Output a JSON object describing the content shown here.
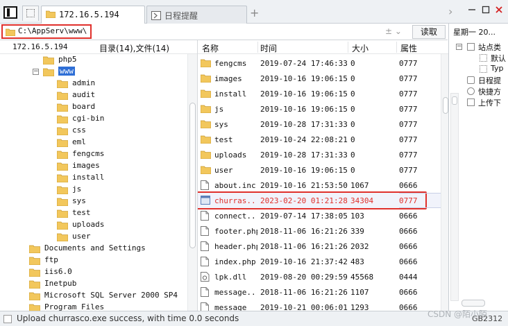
{
  "tabs": {
    "active": {
      "label": "172.16.5.194",
      "icon": "folder-icon"
    },
    "inactive": {
      "label": "日程提醒",
      "icon": "clock-icon"
    },
    "add_label": "+",
    "scroll_right": "›"
  },
  "address": {
    "path": "C:\\AppServ\\www\\",
    "extra": "±  ⌄",
    "read_button": "读取"
  },
  "tree": {
    "host": "172.16.5.194",
    "summary": "目录(14),文件(14)",
    "items": [
      {
        "label": "php5"
      },
      {
        "label": "www"
      },
      {
        "label": "admin"
      },
      {
        "label": "audit"
      },
      {
        "label": "board"
      },
      {
        "label": "cgi-bin"
      },
      {
        "label": "css"
      },
      {
        "label": "eml"
      },
      {
        "label": "fengcms"
      },
      {
        "label": "images"
      },
      {
        "label": "install"
      },
      {
        "label": "js"
      },
      {
        "label": "sys"
      },
      {
        "label": "test"
      },
      {
        "label": "uploads"
      },
      {
        "label": "user"
      },
      {
        "label": "Documents and Settings"
      },
      {
        "label": "ftp"
      },
      {
        "label": "iis6.0"
      },
      {
        "label": "Inetpub"
      },
      {
        "label": "Microsoft SQL Server 2000 SP4"
      },
      {
        "label": "Program Files"
      }
    ]
  },
  "files": {
    "headers": {
      "name": "名称",
      "time": "时间",
      "size": "大小",
      "attr": "属性"
    },
    "rows": [
      {
        "name": "fengcms",
        "time": "2019-07-24 17:46:33",
        "size": "0",
        "attr": "0777",
        "icon": "folder-icon"
      },
      {
        "name": "images",
        "time": "2019-10-16 19:06:15",
        "size": "0",
        "attr": "0777",
        "icon": "folder-icon"
      },
      {
        "name": "install",
        "time": "2019-10-16 19:06:15",
        "size": "0",
        "attr": "0777",
        "icon": "folder-icon"
      },
      {
        "name": "js",
        "time": "2019-10-16 19:06:15",
        "size": "0",
        "attr": "0777",
        "icon": "folder-icon"
      },
      {
        "name": "sys",
        "time": "2019-10-28 17:31:33",
        "size": "0",
        "attr": "0777",
        "icon": "folder-icon"
      },
      {
        "name": "test",
        "time": "2019-10-24 22:08:21",
        "size": "0",
        "attr": "0777",
        "icon": "folder-icon"
      },
      {
        "name": "uploads",
        "time": "2019-10-28 17:31:33",
        "size": "0",
        "attr": "0777",
        "icon": "folder-icon"
      },
      {
        "name": "user",
        "time": "2019-10-16 19:06:15",
        "size": "0",
        "attr": "0777",
        "icon": "folder-icon"
      },
      {
        "name": "about.inc",
        "time": "2019-10-16 21:53:50",
        "size": "1067",
        "attr": "0666",
        "icon": "file-icon"
      },
      {
        "name": "churras...",
        "time": "2023-02-20 01:21:28",
        "size": "34304",
        "attr": "0777",
        "icon": "exe-icon"
      },
      {
        "name": "connect...",
        "time": "2019-07-14 17:38:05",
        "size": "103",
        "attr": "0666",
        "icon": "file-icon"
      },
      {
        "name": "footer.php",
        "time": "2018-11-06 16:21:26",
        "size": "339",
        "attr": "0666",
        "icon": "file-icon"
      },
      {
        "name": "header.php",
        "time": "2018-11-06 16:21:26",
        "size": "2032",
        "attr": "0666",
        "icon": "file-icon"
      },
      {
        "name": "index.php",
        "time": "2019-10-16 21:37:42",
        "size": "483",
        "attr": "0666",
        "icon": "file-icon"
      },
      {
        "name": "lpk.dll",
        "time": "2019-08-20 00:29:59",
        "size": "45568",
        "attr": "0444",
        "icon": "dll-icon"
      },
      {
        "name": "message...",
        "time": "2018-11-06 16:21:26",
        "size": "1107",
        "attr": "0666",
        "icon": "file-icon"
      },
      {
        "name": "message",
        "time": "2019-10-21 00:06:01",
        "size": "1293",
        "attr": "0666",
        "icon": "file-icon"
      }
    ]
  },
  "right_panel": {
    "date": "星期一 20...",
    "items": [
      {
        "label": "站点类"
      },
      {
        "label": "默认"
      },
      {
        "label": "Typ"
      },
      {
        "label": "日程提"
      },
      {
        "label": "快捷方"
      },
      {
        "label": "上传下"
      }
    ]
  },
  "status": {
    "message": "Upload churrasco.exe success, with time 0.0 seconds",
    "encoding": "GB2312",
    "watermark": "CSDN @陌小陌"
  },
  "colors": {
    "highlight_red": "#e0302b",
    "selection_blue": "#2f6fd6",
    "folder_yellow": "#f2c75c"
  }
}
